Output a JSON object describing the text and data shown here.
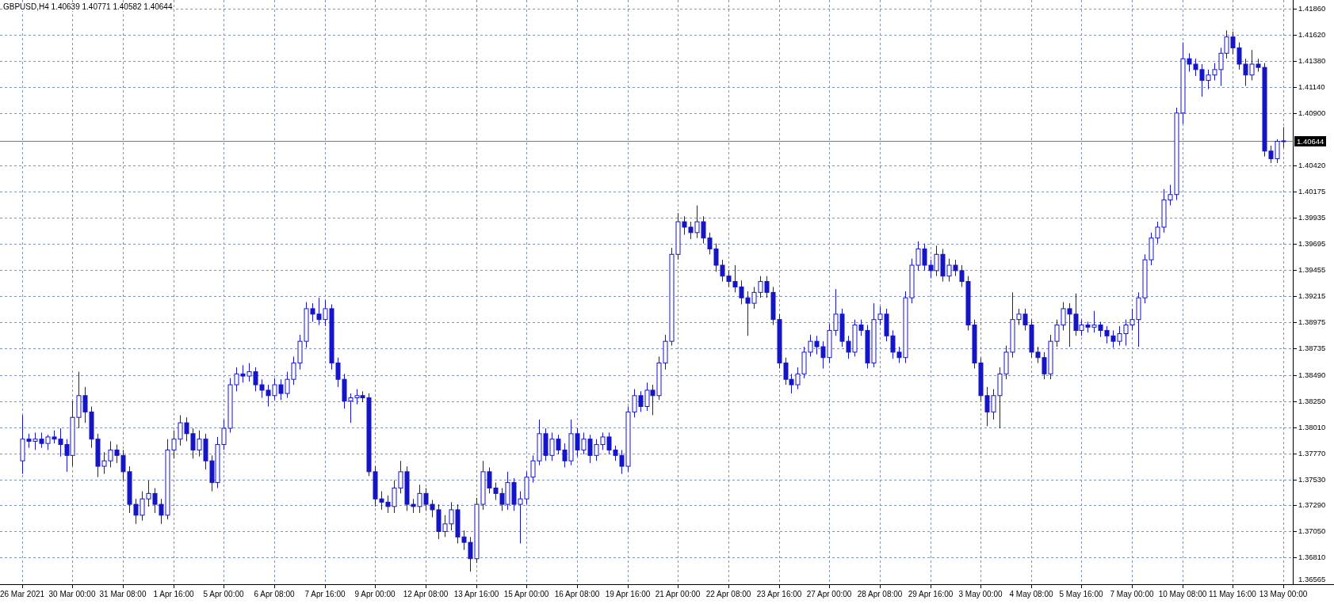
{
  "header": {
    "symbol": "GBPUSD,H4",
    "ohlc": [
      "1.40639",
      "1.40771",
      "1.40582",
      "1.40644"
    ]
  },
  "chart_data": {
    "type": "candlestick",
    "grid": true,
    "ylim": [
      1.36565,
      1.4194
    ],
    "categories": [
      "26 Mar 2021",
      null,
      null,
      null,
      null,
      null,
      null,
      null,
      "30 Mar 00:00",
      null,
      null,
      null,
      null,
      null,
      null,
      null,
      "31 Mar 08:00",
      null,
      null,
      null,
      null,
      null,
      null,
      null,
      "1 Apr 16:00",
      null,
      null,
      null,
      null,
      null,
      null,
      null,
      "5 Apr 00:00",
      null,
      null,
      null,
      null,
      null,
      null,
      null,
      "6 Apr 08:00",
      null,
      null,
      null,
      null,
      null,
      null,
      null,
      "7 Apr 16:00",
      null,
      null,
      null,
      null,
      null,
      null,
      null,
      "9 Apr 00:00",
      null,
      null,
      null,
      null,
      null,
      null,
      null,
      "12 Apr 08:00",
      null,
      null,
      null,
      null,
      null,
      null,
      null,
      "13 Apr 16:00",
      null,
      null,
      null,
      null,
      null,
      null,
      null,
      "15 Apr 00:00",
      null,
      null,
      null,
      null,
      null,
      null,
      null,
      "16 Apr 08:00",
      null,
      null,
      null,
      null,
      null,
      null,
      null,
      "19 Apr 16:00",
      null,
      null,
      null,
      null,
      null,
      null,
      null,
      "21 Apr 00:00",
      null,
      null,
      null,
      null,
      null,
      null,
      null,
      "22 Apr 08:00",
      null,
      null,
      null,
      null,
      null,
      null,
      null,
      "23 Apr 16:00",
      null,
      null,
      null,
      null,
      null,
      null,
      null,
      "27 Apr 00:00",
      null,
      null,
      null,
      null,
      null,
      null,
      null,
      "28 Apr 08:00",
      null,
      null,
      null,
      null,
      null,
      null,
      null,
      "29 Apr 16:00",
      null,
      null,
      null,
      null,
      null,
      null,
      null,
      "3 May 00:00",
      null,
      null,
      null,
      null,
      null,
      null,
      null,
      "4 May 08:00",
      null,
      null,
      null,
      null,
      null,
      null,
      null,
      "5 May 16:00",
      null,
      null,
      null,
      null,
      null,
      null,
      null,
      "7 May 00:00",
      null,
      null,
      null,
      null,
      null,
      null,
      null,
      "10 May 08:00",
      null,
      null,
      null,
      null,
      null,
      null,
      null,
      "11 May 16:00",
      null,
      null,
      null,
      null,
      null,
      null,
      null,
      "13 May 00:00"
    ],
    "yticks": [
      {
        "value": 1.4186,
        "label": "1.41860"
      },
      {
        "value": 1.4162,
        "label": "1.41620"
      },
      {
        "value": 1.4138,
        "label": "1.41380"
      },
      {
        "value": 1.4114,
        "label": "1.41140"
      },
      {
        "value": 1.409,
        "label": "1.40900"
      },
      {
        "value": 1.4042,
        "label": "1.40420"
      },
      {
        "value": 1.40175,
        "label": "1.40175"
      },
      {
        "value": 1.39935,
        "label": "1.39935"
      },
      {
        "value": 1.39695,
        "label": "1.39695"
      },
      {
        "value": 1.39455,
        "label": "1.39455"
      },
      {
        "value": 1.39215,
        "label": "1.39215"
      },
      {
        "value": 1.38975,
        "label": "1.38975"
      },
      {
        "value": 1.38735,
        "label": "1.38735"
      },
      {
        "value": 1.3849,
        "label": "1.38490"
      },
      {
        "value": 1.3825,
        "label": "1.38250"
      },
      {
        "value": 1.3801,
        "label": "1.38010"
      },
      {
        "value": 1.3777,
        "label": "1.37770"
      },
      {
        "value": 1.3753,
        "label": "1.37530"
      },
      {
        "value": 1.3729,
        "label": "1.37290"
      },
      {
        "value": 1.3705,
        "label": "1.37050"
      },
      {
        "value": 1.3681,
        "label": "1.36810"
      },
      {
        "value": 1.36565,
        "label": "1.36565"
      }
    ],
    "ref_lines": [
      {
        "axis": "y",
        "value": 1.40644,
        "label": "1.40644",
        "color": "#7a7a7a"
      }
    ],
    "color": "#1414c8",
    "ohlc": [
      [
        1.377,
        1.3812,
        1.3758,
        1.379
      ],
      [
        1.379,
        1.3795,
        1.3782,
        1.3788
      ],
      [
        1.3788,
        1.3796,
        1.378,
        1.379
      ],
      [
        1.379,
        1.3796,
        1.3782,
        1.3786
      ],
      [
        1.3786,
        1.3794,
        1.378,
        1.3792
      ],
      [
        1.3792,
        1.3798,
        1.3786,
        1.379
      ],
      [
        1.379,
        1.38,
        1.3774,
        1.3785
      ],
      [
        1.3785,
        1.379,
        1.376,
        1.3775
      ],
      [
        1.3775,
        1.3825,
        1.3765,
        1.381
      ],
      [
        1.381,
        1.3852,
        1.38,
        1.383
      ],
      [
        1.383,
        1.3838,
        1.3805,
        1.3815
      ],
      [
        1.3815,
        1.382,
        1.3782,
        1.379
      ],
      [
        1.379,
        1.3795,
        1.3755,
        1.3765
      ],
      [
        1.3765,
        1.3778,
        1.3758,
        1.377
      ],
      [
        1.377,
        1.3788,
        1.3764,
        1.378
      ],
      [
        1.378,
        1.3785,
        1.3768,
        1.3775
      ],
      [
        1.3775,
        1.378,
        1.3752,
        1.376
      ],
      [
        1.376,
        1.3765,
        1.3722,
        1.373
      ],
      [
        1.373,
        1.3735,
        1.3712,
        1.372
      ],
      [
        1.372,
        1.3742,
        1.3715,
        1.3735
      ],
      [
        1.3735,
        1.3752,
        1.3728,
        1.374
      ],
      [
        1.374,
        1.3745,
        1.3722,
        1.373
      ],
      [
        1.373,
        1.3735,
        1.3712,
        1.372
      ],
      [
        1.372,
        1.379,
        1.3716,
        1.378
      ],
      [
        1.378,
        1.3798,
        1.3772,
        1.379
      ],
      [
        1.379,
        1.3812,
        1.3784,
        1.3805
      ],
      [
        1.3805,
        1.381,
        1.3788,
        1.3795
      ],
      [
        1.3795,
        1.38,
        1.3772,
        1.378
      ],
      [
        1.378,
        1.3798,
        1.3774,
        1.379
      ],
      [
        1.379,
        1.3795,
        1.3762,
        1.377
      ],
      [
        1.377,
        1.3775,
        1.3742,
        1.375
      ],
      [
        1.375,
        1.3792,
        1.3745,
        1.3785
      ],
      [
        1.3785,
        1.3808,
        1.378,
        1.38
      ],
      [
        1.38,
        1.3846,
        1.3796,
        1.384
      ],
      [
        1.384,
        1.3856,
        1.3834,
        1.385
      ],
      [
        1.385,
        1.3858,
        1.3842,
        1.3848
      ],
      [
        1.3848,
        1.386,
        1.3843,
        1.3852
      ],
      [
        1.3852,
        1.3856,
        1.3834,
        1.384
      ],
      [
        1.384,
        1.3845,
        1.3828,
        1.3835
      ],
      [
        1.3835,
        1.384,
        1.382,
        1.383
      ],
      [
        1.383,
        1.3846,
        1.3826,
        1.384
      ],
      [
        1.384,
        1.3845,
        1.3826,
        1.3832
      ],
      [
        1.3832,
        1.3852,
        1.3828,
        1.3845
      ],
      [
        1.3845,
        1.3866,
        1.384,
        1.386
      ],
      [
        1.386,
        1.3886,
        1.3854,
        1.388
      ],
      [
        1.388,
        1.3916,
        1.3874,
        1.391
      ],
      [
        1.391,
        1.3915,
        1.3898,
        1.3905
      ],
      [
        1.3905,
        1.392,
        1.3895,
        1.39
      ],
      [
        1.39,
        1.3918,
        1.3894,
        1.391
      ],
      [
        1.391,
        1.3914,
        1.3854,
        1.386
      ],
      [
        1.386,
        1.3865,
        1.3838,
        1.3845
      ],
      [
        1.3845,
        1.385,
        1.3818,
        1.3825
      ],
      [
        1.3825,
        1.3832,
        1.3805,
        1.3828
      ],
      [
        1.3828,
        1.3836,
        1.3822,
        1.383
      ],
      [
        1.383,
        1.3834,
        1.3824,
        1.3828
      ],
      [
        1.3828,
        1.3832,
        1.3756,
        1.376
      ],
      [
        1.376,
        1.3765,
        1.3728,
        1.3735
      ],
      [
        1.3735,
        1.3742,
        1.3725,
        1.3732
      ],
      [
        1.3732,
        1.3738,
        1.3722,
        1.3728
      ],
      [
        1.3728,
        1.3752,
        1.3722,
        1.3745
      ],
      [
        1.3745,
        1.377,
        1.374,
        1.376
      ],
      [
        1.376,
        1.3765,
        1.3724,
        1.373
      ],
      [
        1.373,
        1.3735,
        1.3722,
        1.3728
      ],
      [
        1.3728,
        1.3748,
        1.3722,
        1.374
      ],
      [
        1.374,
        1.3745,
        1.3724,
        1.373
      ],
      [
        1.373,
        1.3734,
        1.3718,
        1.3725
      ],
      [
        1.3725,
        1.373,
        1.3698,
        1.3705
      ],
      [
        1.3705,
        1.372,
        1.37,
        1.3712
      ],
      [
        1.3712,
        1.3732,
        1.3706,
        1.3725
      ],
      [
        1.3725,
        1.373,
        1.3694,
        1.37
      ],
      [
        1.37,
        1.3706,
        1.3688,
        1.3695
      ],
      [
        1.3695,
        1.37,
        1.3668,
        1.368
      ],
      [
        1.368,
        1.3736,
        1.3676,
        1.373
      ],
      [
        1.373,
        1.377,
        1.3725,
        1.376
      ],
      [
        1.376,
        1.3764,
        1.374,
        1.3745
      ],
      [
        1.3745,
        1.375,
        1.3734,
        1.374
      ],
      [
        1.374,
        1.3745,
        1.3724,
        1.373
      ],
      [
        1.373,
        1.376,
        1.3725,
        1.375
      ],
      [
        1.375,
        1.3754,
        1.3724,
        1.373
      ],
      [
        1.373,
        1.3742,
        1.3694,
        1.3735
      ],
      [
        1.3735,
        1.376,
        1.373,
        1.3755
      ],
      [
        1.3755,
        1.3775,
        1.375,
        1.377
      ],
      [
        1.377,
        1.3808,
        1.3766,
        1.3795
      ],
      [
        1.3795,
        1.38,
        1.377,
        1.3775
      ],
      [
        1.3775,
        1.3796,
        1.377,
        1.379
      ],
      [
        1.379,
        1.3794,
        1.3776,
        1.378
      ],
      [
        1.378,
        1.3786,
        1.3764,
        1.377
      ],
      [
        1.377,
        1.3808,
        1.3766,
        1.3795
      ],
      [
        1.3795,
        1.38,
        1.3774,
        1.378
      ],
      [
        1.378,
        1.3796,
        1.3776,
        1.379
      ],
      [
        1.379,
        1.3794,
        1.3768,
        1.3775
      ],
      [
        1.3775,
        1.379,
        1.377,
        1.3785
      ],
      [
        1.3785,
        1.3796,
        1.378,
        1.3792
      ],
      [
        1.3792,
        1.3796,
        1.3776,
        1.378
      ],
      [
        1.378,
        1.3784,
        1.377,
        1.3775
      ],
      [
        1.3775,
        1.378,
        1.3758,
        1.3765
      ],
      [
        1.3765,
        1.382,
        1.376,
        1.3815
      ],
      [
        1.3815,
        1.3836,
        1.381,
        1.383
      ],
      [
        1.383,
        1.3834,
        1.3815,
        1.382
      ],
      [
        1.382,
        1.3842,
        1.3816,
        1.3835
      ],
      [
        1.3835,
        1.384,
        1.3812,
        1.383
      ],
      [
        1.383,
        1.3866,
        1.3826,
        1.386
      ],
      [
        1.386,
        1.3886,
        1.3854,
        1.388
      ],
      [
        1.388,
        1.3966,
        1.3876,
        1.396
      ],
      [
        1.396,
        1.3998,
        1.3955,
        1.399
      ],
      [
        1.399,
        1.3995,
        1.3978,
        1.3985
      ],
      [
        1.3985,
        1.399,
        1.3974,
        1.398
      ],
      [
        1.398,
        1.4005,
        1.3975,
        1.399
      ],
      [
        1.399,
        1.3995,
        1.397,
        1.3975
      ],
      [
        1.3975,
        1.398,
        1.396,
        1.3965
      ],
      [
        1.3965,
        1.397,
        1.3944,
        1.395
      ],
      [
        1.395,
        1.3955,
        1.3935,
        1.394
      ],
      [
        1.394,
        1.3945,
        1.393,
        1.3935
      ],
      [
        1.3935,
        1.395,
        1.3925,
        1.393
      ],
      [
        1.393,
        1.3936,
        1.3914,
        1.392
      ],
      [
        1.392,
        1.3926,
        1.3885,
        1.3915
      ],
      [
        1.3915,
        1.393,
        1.391,
        1.3925
      ],
      [
        1.3925,
        1.394,
        1.392,
        1.3935
      ],
      [
        1.3935,
        1.394,
        1.392,
        1.3925
      ],
      [
        1.3925,
        1.393,
        1.3895,
        1.39
      ],
      [
        1.39,
        1.3905,
        1.3855,
        1.386
      ],
      [
        1.386,
        1.3865,
        1.384,
        1.3845
      ],
      [
        1.3845,
        1.385,
        1.3832,
        1.384
      ],
      [
        1.384,
        1.3856,
        1.3836,
        1.385
      ],
      [
        1.385,
        1.3875,
        1.3846,
        1.387
      ],
      [
        1.387,
        1.3886,
        1.3866,
        1.388
      ],
      [
        1.388,
        1.3885,
        1.3868,
        1.3875
      ],
      [
        1.3875,
        1.388,
        1.3855,
        1.3865
      ],
      [
        1.3865,
        1.3896,
        1.386,
        1.389
      ],
      [
        1.389,
        1.3928,
        1.3885,
        1.3905
      ],
      [
        1.3905,
        1.391,
        1.3875,
        1.388
      ],
      [
        1.388,
        1.3885,
        1.3864,
        1.387
      ],
      [
        1.387,
        1.39,
        1.3866,
        1.3895
      ],
      [
        1.3895,
        1.39,
        1.3885,
        1.389
      ],
      [
        1.389,
        1.3895,
        1.3855,
        1.386
      ],
      [
        1.386,
        1.3915,
        1.3856,
        1.39
      ],
      [
        1.39,
        1.3912,
        1.3895,
        1.3905
      ],
      [
        1.3905,
        1.391,
        1.388,
        1.3885
      ],
      [
        1.3885,
        1.389,
        1.3864,
        1.387
      ],
      [
        1.387,
        1.3875,
        1.386,
        1.3865
      ],
      [
        1.3865,
        1.3926,
        1.386,
        1.392
      ],
      [
        1.392,
        1.3956,
        1.3915,
        1.395
      ],
      [
        1.395,
        1.3972,
        1.3945,
        1.3965
      ],
      [
        1.3965,
        1.397,
        1.3945,
        1.395
      ],
      [
        1.395,
        1.3955,
        1.3938,
        1.3945
      ],
      [
        1.3945,
        1.3968,
        1.394,
        1.396
      ],
      [
        1.396,
        1.3965,
        1.3935,
        1.394
      ],
      [
        1.394,
        1.3956,
        1.3935,
        1.395
      ],
      [
        1.395,
        1.3955,
        1.394,
        1.3945
      ],
      [
        1.3945,
        1.395,
        1.393,
        1.3935
      ],
      [
        1.3935,
        1.394,
        1.389,
        1.3895
      ],
      [
        1.3895,
        1.39,
        1.3855,
        1.386
      ],
      [
        1.386,
        1.3865,
        1.3825,
        1.383
      ],
      [
        1.383,
        1.3838,
        1.3802,
        1.3815
      ],
      [
        1.3815,
        1.3836,
        1.3808,
        1.383
      ],
      [
        1.383,
        1.3856,
        1.38,
        1.385
      ],
      [
        1.385,
        1.3876,
        1.3845,
        1.387
      ],
      [
        1.387,
        1.3925,
        1.3865,
        1.39
      ],
      [
        1.39,
        1.391,
        1.3895,
        1.3905
      ],
      [
        1.3905,
        1.391,
        1.389,
        1.3895
      ],
      [
        1.3895,
        1.39,
        1.3865,
        1.387
      ],
      [
        1.387,
        1.3875,
        1.386,
        1.3865
      ],
      [
        1.3865,
        1.387,
        1.3845,
        1.385
      ],
      [
        1.385,
        1.3886,
        1.3845,
        1.388
      ],
      [
        1.388,
        1.39,
        1.3875,
        1.3895
      ],
      [
        1.3895,
        1.3916,
        1.389,
        1.391
      ],
      [
        1.391,
        1.3915,
        1.3875,
        1.3905
      ],
      [
        1.3905,
        1.3924,
        1.3885,
        1.389
      ],
      [
        1.389,
        1.39,
        1.3885,
        1.3895
      ],
      [
        1.3895,
        1.3898,
        1.3888,
        1.3893
      ],
      [
        1.3893,
        1.3908,
        1.3888,
        1.3895
      ],
      [
        1.3895,
        1.3898,
        1.3884,
        1.389
      ],
      [
        1.389,
        1.3894,
        1.3878,
        1.3885
      ],
      [
        1.3885,
        1.389,
        1.3874,
        1.388
      ],
      [
        1.388,
        1.3894,
        1.3876,
        1.3887
      ],
      [
        1.3887,
        1.39,
        1.3876,
        1.3895
      ],
      [
        1.3895,
        1.391,
        1.389,
        1.39
      ],
      [
        1.39,
        1.3925,
        1.3875,
        1.392
      ],
      [
        1.392,
        1.396,
        1.3915,
        1.3955
      ],
      [
        1.3955,
        1.398,
        1.395,
        1.3975
      ],
      [
        1.3975,
        1.399,
        1.397,
        1.3985
      ],
      [
        1.3985,
        1.402,
        1.398,
        1.401
      ],
      [
        1.401,
        1.4024,
        1.4005,
        1.4015
      ],
      [
        1.4015,
        1.4095,
        1.401,
        1.409
      ],
      [
        1.409,
        1.4155,
        1.408,
        1.414
      ],
      [
        1.414,
        1.4145,
        1.4128,
        1.4135
      ],
      [
        1.4135,
        1.414,
        1.4124,
        1.413
      ],
      [
        1.413,
        1.4135,
        1.4105,
        1.412
      ],
      [
        1.412,
        1.413,
        1.4112,
        1.4125
      ],
      [
        1.4125,
        1.4136,
        1.412,
        1.413
      ],
      [
        1.413,
        1.415,
        1.4115,
        1.4145
      ],
      [
        1.4145,
        1.4166,
        1.414,
        1.416
      ],
      [
        1.416,
        1.4165,
        1.4144,
        1.415
      ],
      [
        1.415,
        1.4155,
        1.413,
        1.4135
      ],
      [
        1.4135,
        1.414,
        1.4115,
        1.4125
      ],
      [
        1.4125,
        1.4148,
        1.412,
        1.4135
      ],
      [
        1.4135,
        1.414,
        1.4128,
        1.4132
      ],
      [
        1.4132,
        1.4136,
        1.405,
        1.4055
      ],
      [
        1.4055,
        1.406,
        1.4044,
        1.4048
      ],
      [
        1.4048,
        1.4066,
        1.4044,
        1.4064
      ],
      [
        1.40639,
        1.40771,
        1.40582,
        1.40644
      ]
    ]
  }
}
